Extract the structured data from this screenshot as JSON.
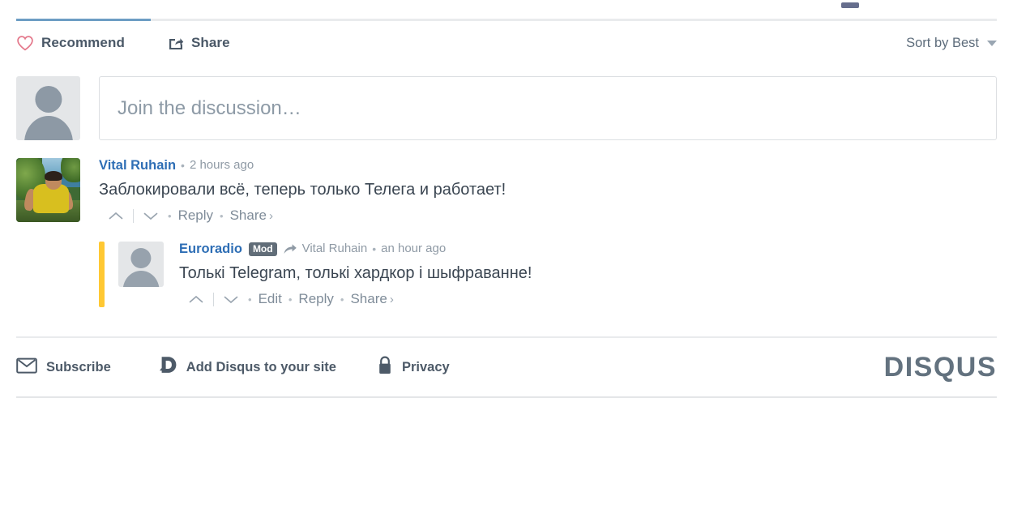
{
  "toolbar": {
    "recommend_label": "Recommend",
    "share_label": "Share",
    "sort_label": "Sort by Best",
    "heart_icon": "heart-icon",
    "share_icon": "share-icon",
    "caret_icon": "chevron-down-icon"
  },
  "composer": {
    "placeholder": "Join the discussion…",
    "avatar_icon": "default-avatar-icon"
  },
  "comments": [
    {
      "author": "Vital Ruhain",
      "time": "2 hours ago",
      "text": "Заблокировали всё, теперь только Телега и работает!",
      "separator": "•",
      "actions": {
        "upvote_icon": "chevron-up-icon",
        "downvote_icon": "chevron-down-icon",
        "reply": "Reply",
        "share": "Share",
        "share_chevron": "›",
        "dot": "•"
      }
    }
  ],
  "reply": {
    "author": "Euroradio",
    "badge": "Mod",
    "reply_arrow_icon": "reply-arrow-icon",
    "parent_author": "Vital Ruhain",
    "separator": "•",
    "time": "an hour ago",
    "text": "Толькі Telegram, толькі хардкор і шыфраванне!",
    "actions": {
      "upvote_icon": "chevron-up-icon",
      "downvote_icon": "chevron-down-icon",
      "edit": "Edit",
      "reply": "Reply",
      "share": "Share",
      "share_chevron": "›",
      "dot": "•"
    }
  },
  "footer": {
    "subscribe_label": "Subscribe",
    "subscribe_icon": "envelope-icon",
    "add_disqus_label": "Add Disqus to your site",
    "add_disqus_icon": "disqus-d-icon",
    "privacy_label": "Privacy",
    "privacy_icon": "lock-icon",
    "logo": "DISQUS"
  },
  "colors": {
    "tab_active": "#6d9dc4",
    "link_blue": "#2e6eb5",
    "heart_red": "#e4798c",
    "mod_badge": "#616d78",
    "highlight_yellow": "#ffc833",
    "logo_gray": "#63727f"
  }
}
